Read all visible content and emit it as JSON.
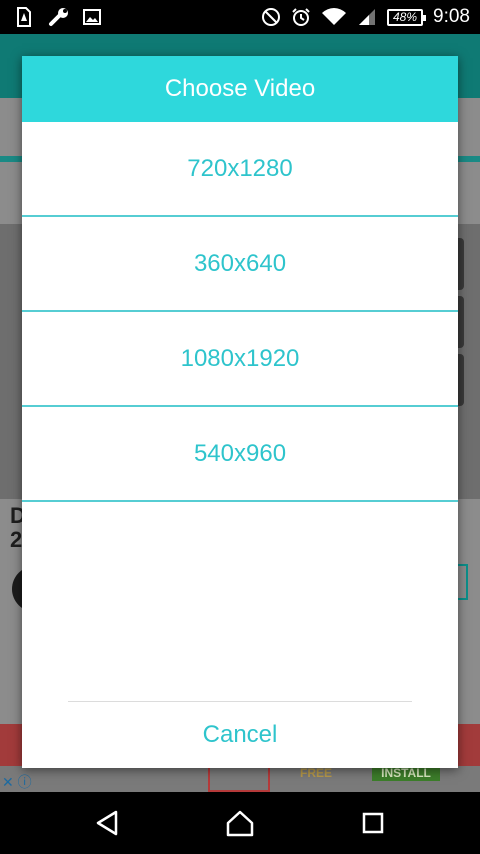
{
  "status_bar": {
    "left_icons": [
      "sim-alert-icon",
      "wrench-icon",
      "image-icon"
    ],
    "right_icons": [
      "do-not-disturb-icon",
      "alarm-icon",
      "wifi-icon",
      "cell-signal-icon"
    ],
    "battery": "48%",
    "time": "9:08"
  },
  "background_app": {
    "partial_text_line1": "D",
    "partial_text_line2": "2",
    "ad_free_label": "FREE",
    "ad_install_label": "INSTALL"
  },
  "dialog": {
    "title": "Choose Video",
    "options": [
      {
        "label": "720x1280"
      },
      {
        "label": "360x640"
      },
      {
        "label": "1080x1920"
      },
      {
        "label": "540x960"
      }
    ],
    "cancel_label": "Cancel"
  },
  "nav_bar": {
    "icons": [
      "back-icon",
      "home-icon",
      "recents-icon"
    ]
  },
  "colors": {
    "accent": "#2ed8dc",
    "option_text": "#2ec4cc",
    "divider": "#56cdd3"
  }
}
